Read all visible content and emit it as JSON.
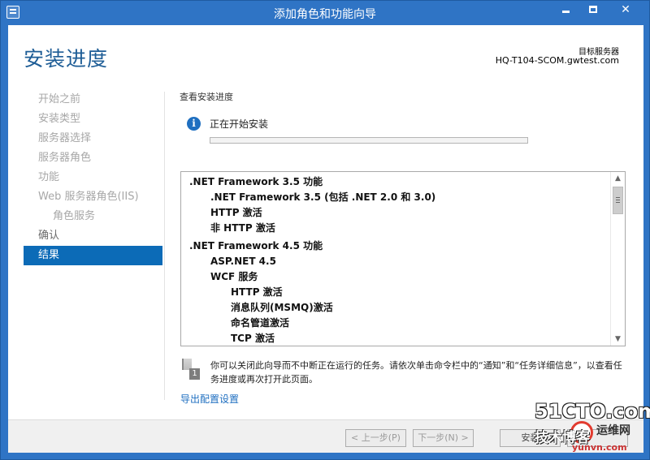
{
  "window": {
    "title": "添加角色和功能向导",
    "controls": {
      "minimize": "",
      "maximize": "",
      "close": "✕"
    }
  },
  "header": {
    "title": "安装进度",
    "target_label": "目标服务器",
    "target_server": "HQ-T104-SCOM.gwtest.com"
  },
  "sidebar": {
    "items": [
      {
        "label": "开始之前",
        "state": "disabled"
      },
      {
        "label": "安装类型",
        "state": "disabled"
      },
      {
        "label": "服务器选择",
        "state": "disabled"
      },
      {
        "label": "服务器角色",
        "state": "disabled"
      },
      {
        "label": "功能",
        "state": "disabled"
      },
      {
        "label": "Web 服务器角色(IIS)",
        "state": "disabled"
      },
      {
        "label": "角色服务",
        "state": "disabled"
      },
      {
        "label": "确认",
        "state": "enabled"
      },
      {
        "label": "结果",
        "state": "active"
      }
    ]
  },
  "main": {
    "section_label": "查看安装进度",
    "status_text": "正在开始安装",
    "progress": 0,
    "features": [
      {
        "label": ".NET Framework 3.5 功能",
        "level": 0
      },
      {
        "label": ".NET Framework 3.5 (包括 .NET 2.0 和 3.0)",
        "level": 1
      },
      {
        "label": "HTTP 激活",
        "level": 1
      },
      {
        "label": "非 HTTP 激活",
        "level": 1
      },
      {
        "label": ".NET Framework 4.5 功能",
        "level": 0
      },
      {
        "label": "ASP.NET 4.5",
        "level": 1
      },
      {
        "label": "WCF 服务",
        "level": 1
      },
      {
        "label": "HTTP 激活",
        "level": 2
      },
      {
        "label": "消息队列(MSMQ)激活",
        "level": 2
      },
      {
        "label": "命名管道激活",
        "level": 2
      },
      {
        "label": "TCP 激活",
        "level": 2
      }
    ],
    "note_icon_number": "1",
    "note_text": "你可以关闭此向导而不中断正在运行的任务。请依次单击命令栏中的“通知”和“任务详细信息”，以查看任务进度或再次打开此页面。",
    "export_link": "导出配置设置"
  },
  "footer": {
    "prev_label": "< 上一步(P)",
    "next_label": "下一步(N) >",
    "install_label": "安装"
  },
  "watermark": {
    "site": "51CTO.com",
    "tech": "技术博客",
    "yunwei": "运维网",
    "url": "yunvn.com"
  }
}
